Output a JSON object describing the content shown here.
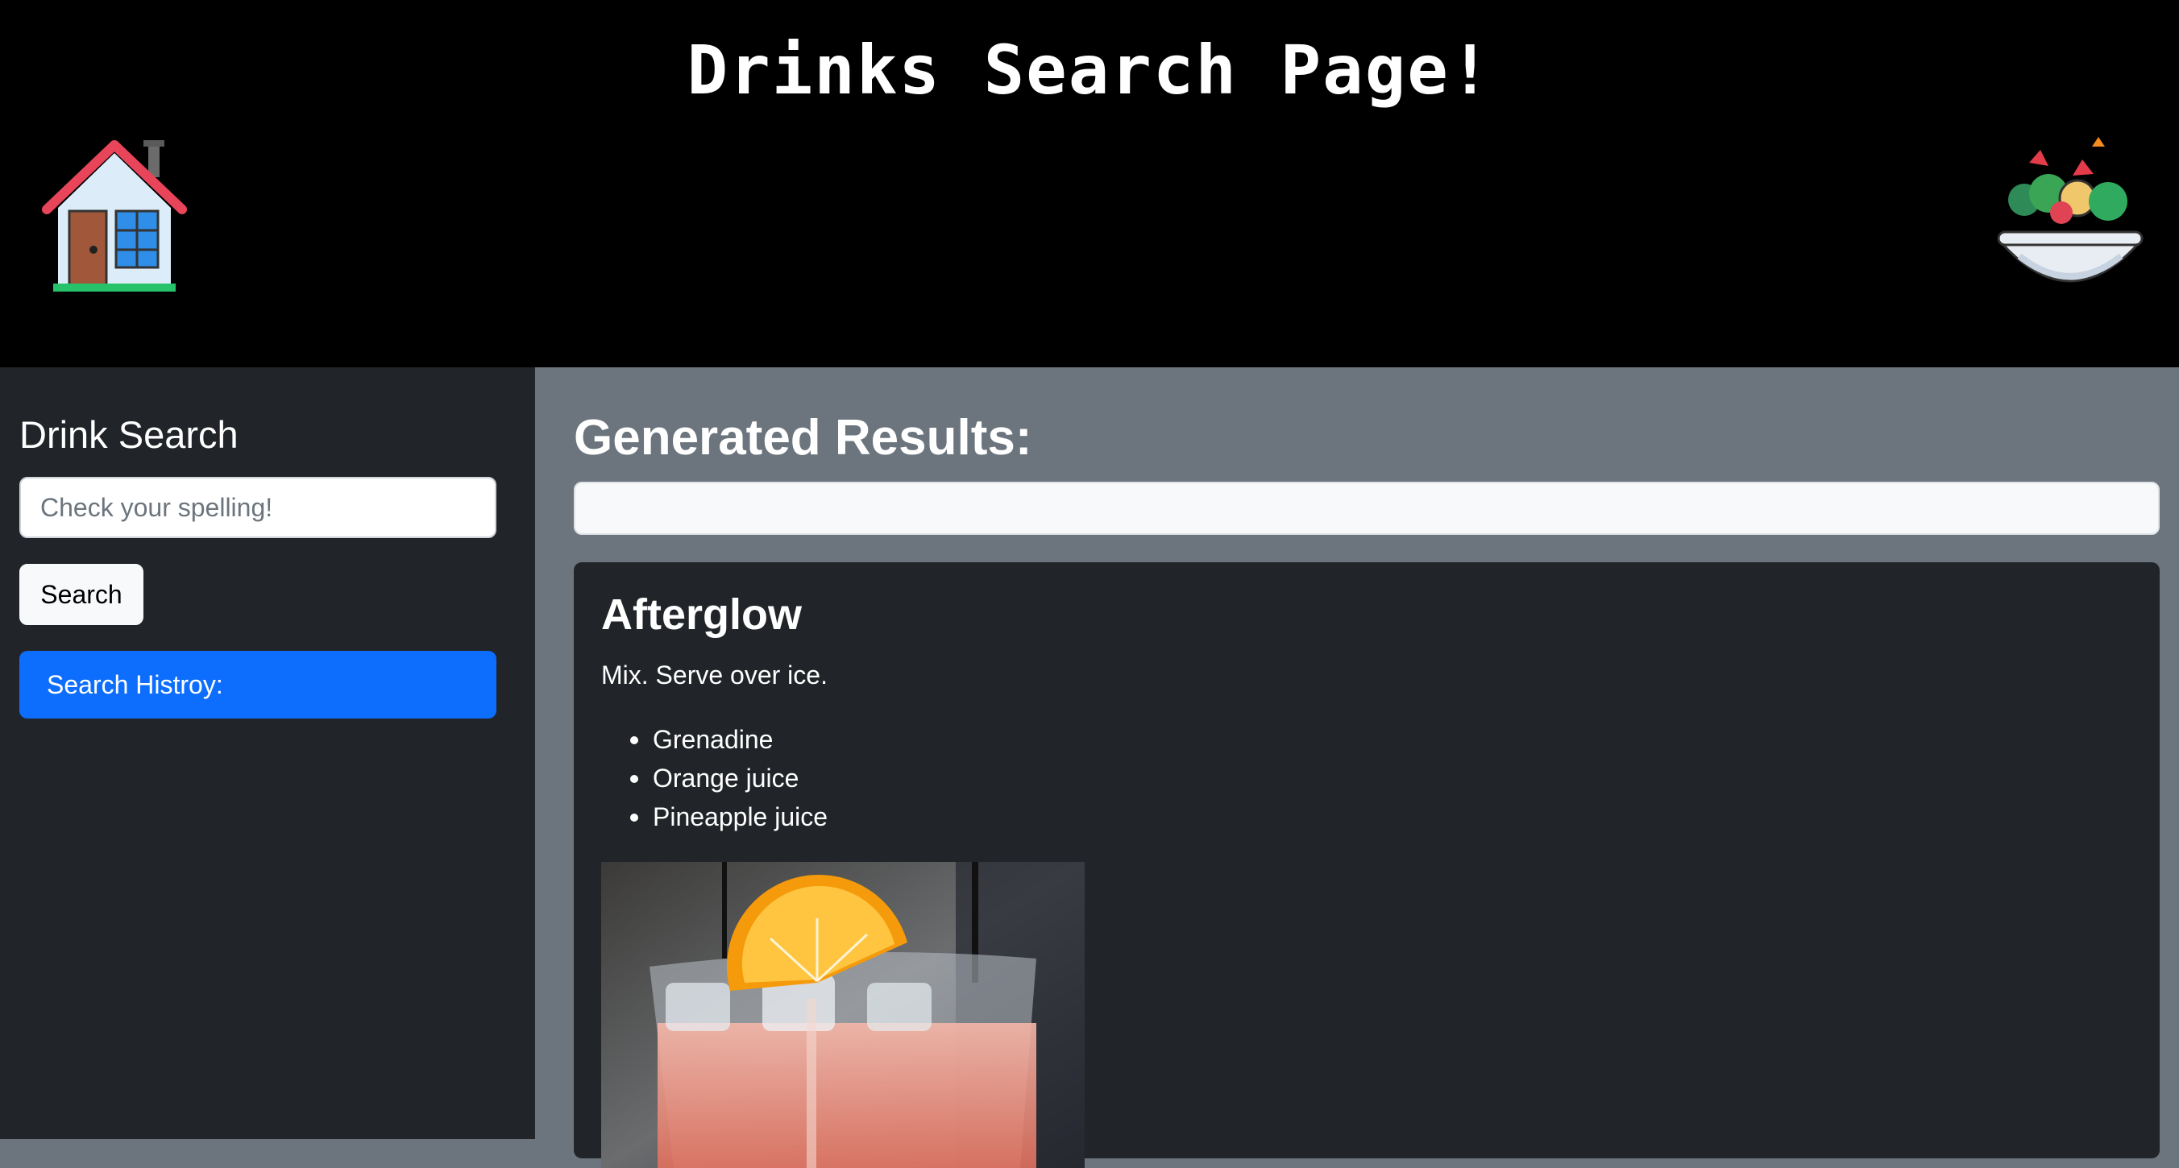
{
  "header": {
    "title": "Drinks Search Page!",
    "home_icon": "house-icon",
    "food_icon": "salad-bowl-icon"
  },
  "sidebar": {
    "title": "Drink Search",
    "search_placeholder": "Check your spelling!",
    "search_value": "",
    "search_button": "Search",
    "history_button": "Search Histroy:"
  },
  "main": {
    "title": "Generated Results:",
    "results_value": "",
    "card": {
      "name": "Afterglow",
      "instructions": "Mix. Serve over ice.",
      "ingredients": [
        "Grenadine",
        "Orange juice",
        "Pineapple juice"
      ],
      "image_subject": "drink-photo"
    }
  },
  "colors": {
    "header_bg": "#000000",
    "sidebar_bg": "#212529",
    "main_bg": "#6c757d",
    "primary": "#0d6efd",
    "light": "#f8f9fa"
  }
}
